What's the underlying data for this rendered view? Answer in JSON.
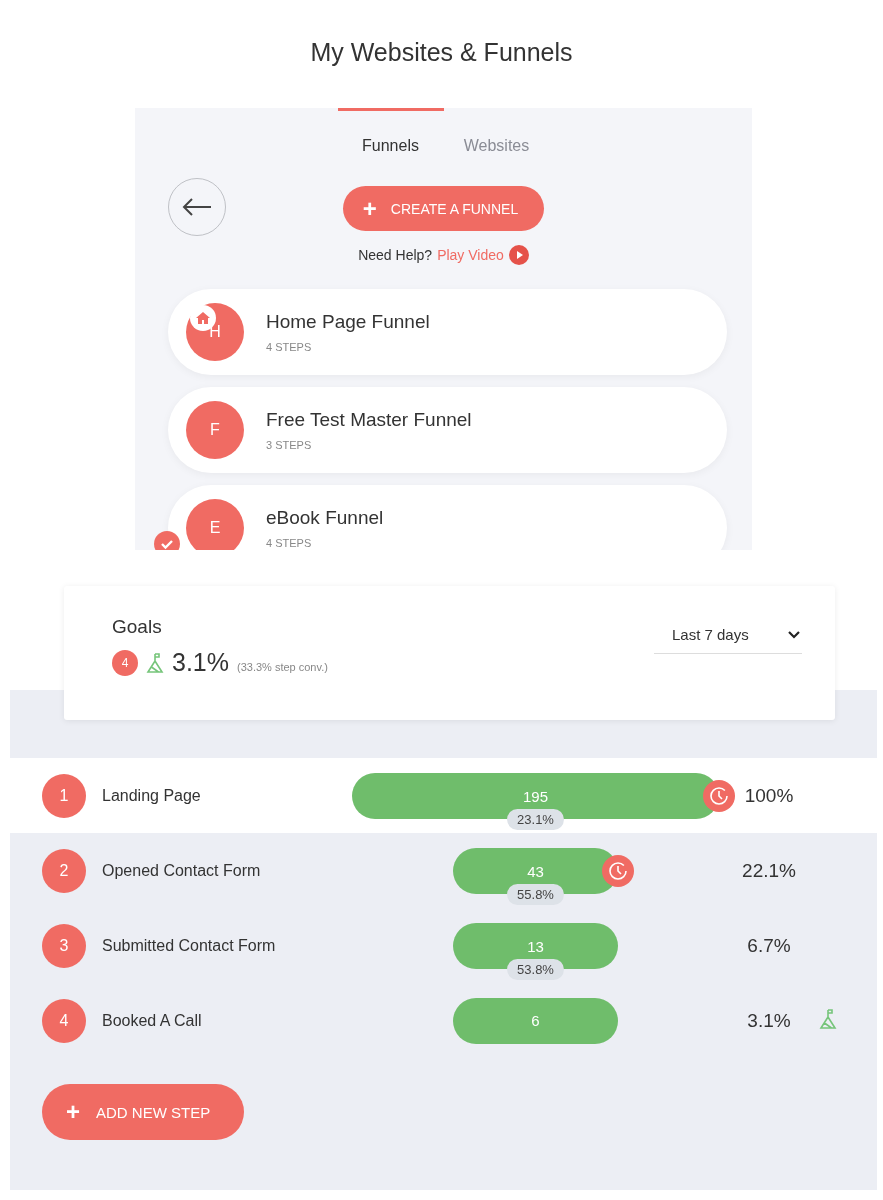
{
  "title": "My Websites & Funnels",
  "tabs": [
    {
      "label": "Funnels",
      "selected": true
    },
    {
      "label": "Websites",
      "selected": false
    }
  ],
  "create_button": {
    "icon": "+",
    "label": "CREATE A FUNNEL"
  },
  "help": {
    "text": "Need Help?",
    "link": "Play Video"
  },
  "funnels": [
    {
      "initial": "H",
      "name": "Home Page Funnel",
      "steps": "4 STEPS",
      "home": true,
      "checked": false
    },
    {
      "initial": "F",
      "name": "Free Test Master Funnel",
      "steps": "3 STEPS",
      "home": false,
      "checked": false
    },
    {
      "initial": "E",
      "name": "eBook Funnel",
      "steps": "4 STEPS",
      "home": false,
      "checked": true
    }
  ],
  "goals": {
    "title": "Goals",
    "count": "4",
    "rate": "3.1%",
    "step_conv": "(33.3% step conv.)",
    "range": "Last 7 days"
  },
  "steps": [
    {
      "number": "1",
      "name": "Landing Page",
      "count": "195",
      "wide": true,
      "drop": "23.1%",
      "percent": "100%",
      "timer": true,
      "goal": false,
      "selected": true
    },
    {
      "number": "2",
      "name": "Opened Contact Form",
      "count": "43",
      "wide": false,
      "drop": "55.8%",
      "percent": "22.1%",
      "timer": true,
      "goal": false,
      "selected": false
    },
    {
      "number": "3",
      "name": "Submitted Contact Form",
      "count": "13",
      "wide": false,
      "drop": "53.8%",
      "percent": "6.7%",
      "timer": false,
      "goal": false,
      "selected": false
    },
    {
      "number": "4",
      "name": "Booked A Call",
      "count": "6",
      "wide": false,
      "percent": "3.1%",
      "timer": false,
      "goal": true,
      "selected": false
    }
  ],
  "add_button": {
    "icon": "+",
    "label": "ADD NEW STEP"
  }
}
